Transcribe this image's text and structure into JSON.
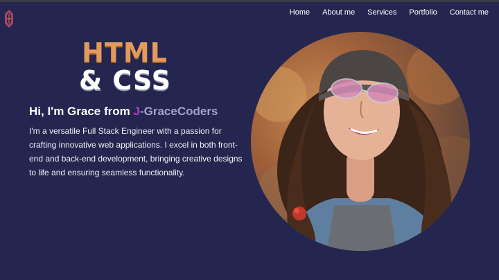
{
  "nav": {
    "items": [
      "Home",
      "About me",
      "Services",
      "Portfolio",
      "Contact me"
    ]
  },
  "hero": {
    "headline_line1": "HTML",
    "headline_line2": "& CSS",
    "greeting_prefix": "Hi, I'm Grace from ",
    "greeting_accent": "J",
    "greeting_brand": "-GraceCoders",
    "intro": "I'm a versatile Full Stack Engineer with a passion for crafting innovative web applications. I excel in both front-end and back-end development, bringing creative designs to life and ensuring seamless functionality."
  },
  "colors": {
    "background": "#242650",
    "accent": "#b43ac6",
    "headline_orange": "#e39b5d"
  },
  "icons": [
    "logo-icon"
  ]
}
